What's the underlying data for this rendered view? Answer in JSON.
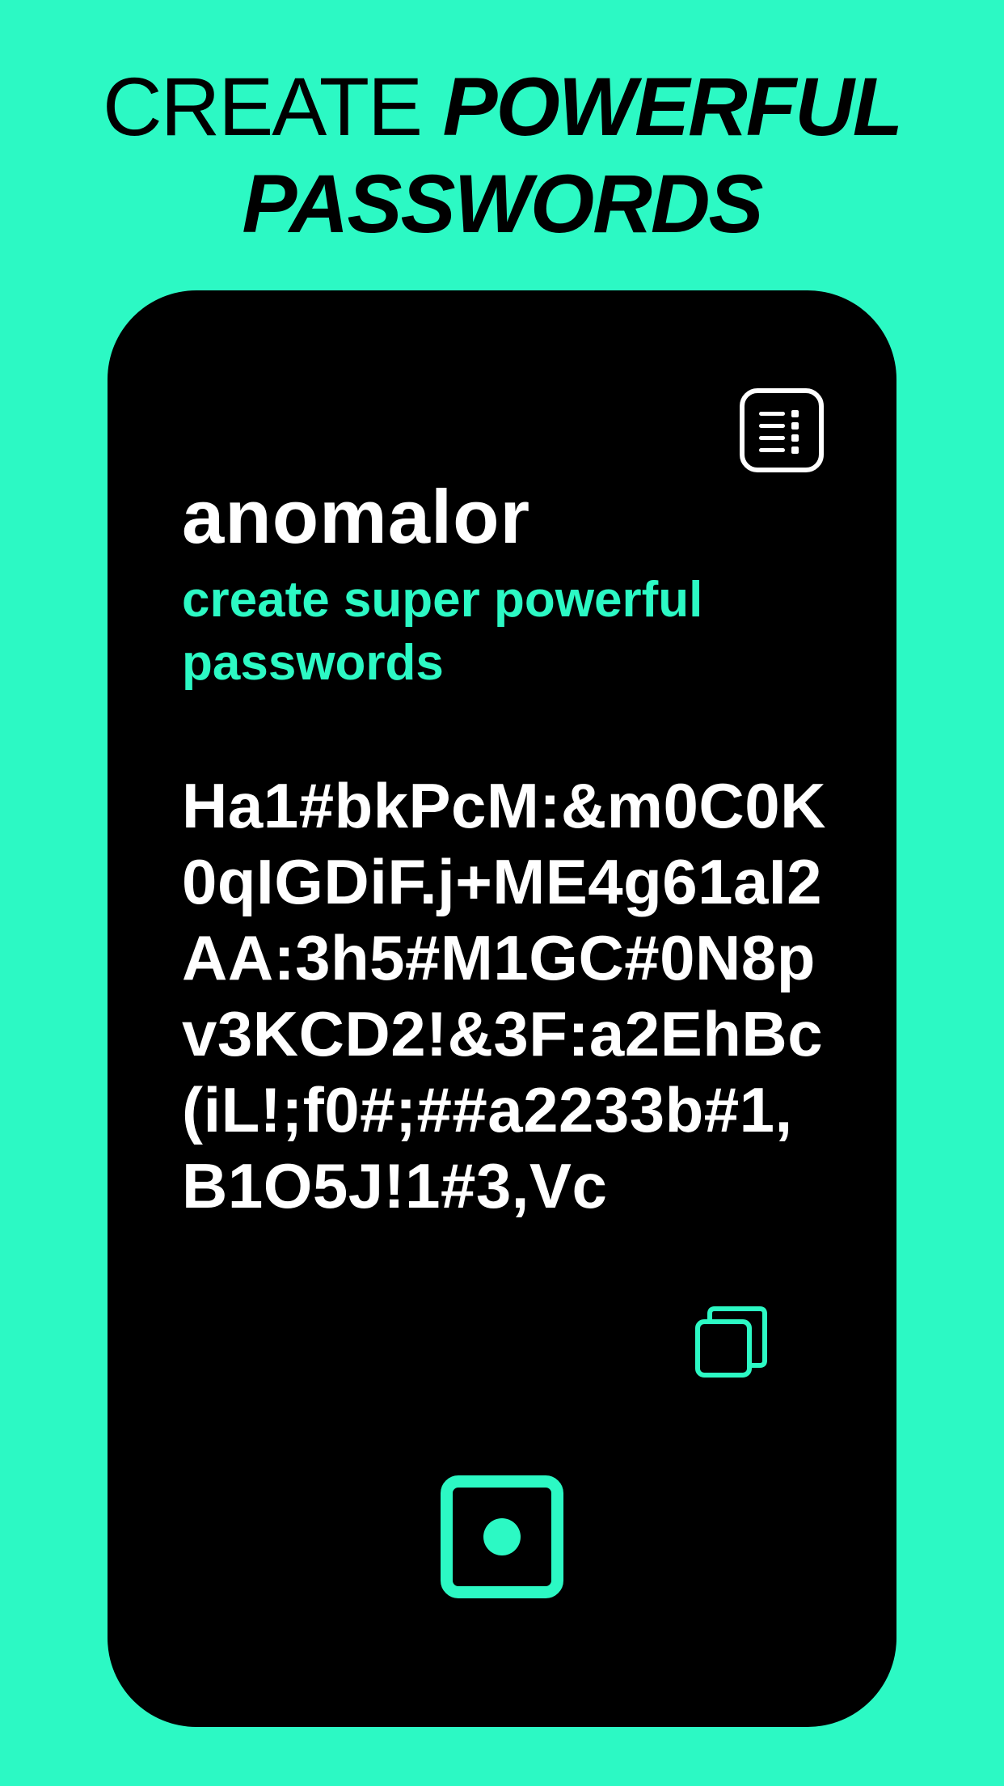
{
  "headline": {
    "line1_light": "CREATE ",
    "line1_strong": "POWERFUL",
    "line2": "PASSWORDS"
  },
  "app": {
    "name": "anomalor",
    "tagline": "create super powerful passwords",
    "password": "Ha1#bkPcM:&m0C0K0qIGDiF.j+ME4g61aI2AA:3h5#M1GC#0N8pv3KCD2!&3F:a2EhBc(iL!;f0#;##a2233b#1,B1O5J!1#3,Vc"
  },
  "icons": {
    "menu": "menu-list-icon",
    "copy": "copy-icon",
    "generate": "generate-icon"
  },
  "colors": {
    "accent": "#2cf9c4",
    "card": "#000000",
    "text": "#ffffff"
  }
}
